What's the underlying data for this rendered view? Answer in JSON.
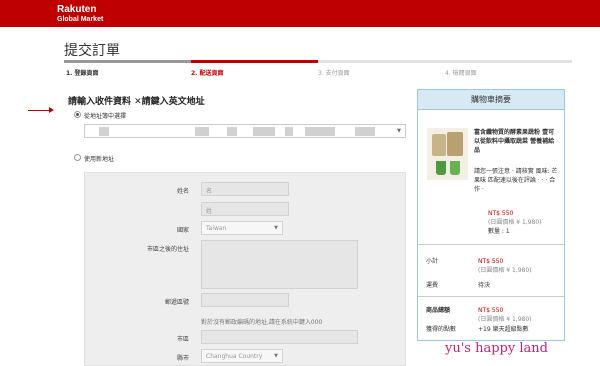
{
  "header": {
    "brand_line1": "Rakuten",
    "brand_line2": "Global Market",
    "brand_color": "#bf0000"
  },
  "page_title": "提交訂單",
  "steps": [
    {
      "label": "1. 登錄頁面",
      "state": "done"
    },
    {
      "label": "2. 配送頁面",
      "state": "active"
    },
    {
      "label": "3. 支付頁面",
      "state": "todo"
    },
    {
      "label": "4. 檢閱頁面",
      "state": "todo"
    }
  ],
  "shipping": {
    "section_title": "請輸入收件資料 ✕請鍵入英文地址",
    "option_existing": "從地址簿中選擇",
    "option_new": "使用新地址",
    "form": {
      "name_label": "姓名",
      "first_placeholder": "名",
      "last_placeholder": "姓",
      "country_label": "國家",
      "country_value": "Taiwan",
      "address_label": "市區之後的住址",
      "zip_label": "郵遞區號",
      "zip_note": "對於沒有郵政編碼的地址,請在系統中鍵入000",
      "city_label": "市區",
      "county_label": "縣市",
      "county_value": "Changhua Country"
    }
  },
  "cart": {
    "title": "購物車摘要",
    "product_name": "富含纖物質的酵素果蔬粉 壹可以從飲料中攝取蔬菜 營養補給品",
    "product_option": "請您一張注意 ‧ 請核實 風味: 芒果味 匹配速以後在評論 ‧ ‧ ‧ 合作 ‧",
    "product_price": "NT$ 550",
    "product_price_jpy": "(日圓價格 ¥ 1,980)",
    "product_qty": "數量 : 1",
    "subtotal_label": "小計",
    "subtotal_value": "NT$ 550",
    "subtotal_jpy": "(日圓價格 ¥ 1,980)",
    "shipping_label": "運費",
    "shipping_value": "待決",
    "total_label": "商品總額",
    "total_value": "NT$ 550",
    "total_jpy": "(日圓價格 ¥ 1,980)",
    "points_label": "獲得的點數",
    "points_value": "+19 樂天超級點數"
  },
  "watermark": "yu's happy land"
}
